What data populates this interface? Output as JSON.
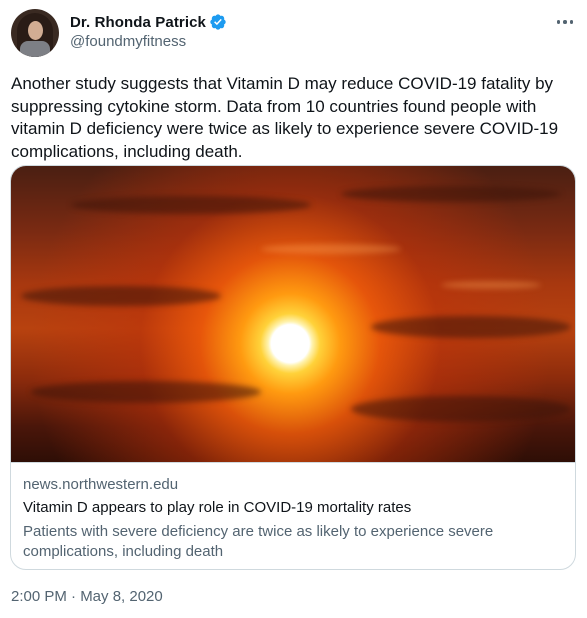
{
  "author": {
    "name": "Dr. Rhonda Patrick",
    "handle": "@foundmyfitness",
    "verified": true,
    "avatar_icon": "profile-photo"
  },
  "menu": {
    "icon": "more-horizontal-icon"
  },
  "tweet": {
    "text": "Another study suggests that Vitamin D may reduce COVID-19 fatality by suppressing cytokine storm. Data from 10 countries found people with vitamin D deficiency were twice as likely to experience severe COVID-19 complications, including death."
  },
  "link_card": {
    "image": "sunset-over-clouds",
    "domain": "news.northwestern.edu",
    "title": "Vitamin D appears to play role in COVID-19 mortality rates",
    "description": "Patients with severe deficiency are twice as likely to experience severe complications, including death"
  },
  "meta": {
    "timestamp": "2:00 PM · May 8, 2020"
  },
  "colors": {
    "text_primary": "#0f1419",
    "text_secondary": "#536471",
    "verified_blue": "#1d9bf0",
    "border": "#cfd9de"
  }
}
